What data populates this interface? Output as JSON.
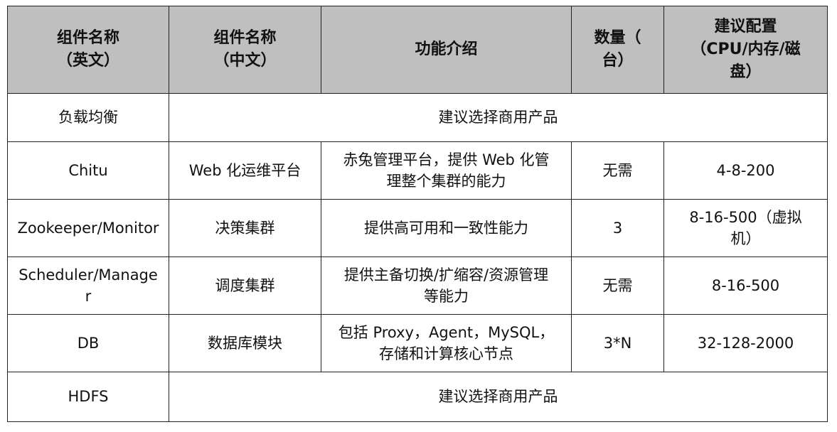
{
  "header": {
    "name_en": [
      "组件名称",
      "（英文）"
    ],
    "name_zh": [
      "组件名称",
      "（中文）"
    ],
    "function": "功能介绍",
    "quantity": [
      "数量（",
      "台）"
    ],
    "config": [
      "建议配置",
      "（CPU/内存/磁",
      "盘）"
    ]
  },
  "rows": {
    "load_balancer": {
      "name_en": "负载均衡",
      "merged_note": "建议选择商用产品"
    },
    "chitu": {
      "name_en": "Chitu",
      "name_zh": "Web 化运维平台",
      "function": [
        "赤兔管理平台，提供 Web 化管",
        "理整个集群的能力"
      ],
      "quantity": "无需",
      "config": "4-8-200"
    },
    "zookeeper": {
      "name_en": "Zookeeper/Monitor",
      "name_zh": "决策集群",
      "function": "提供高可用和一致性能力",
      "quantity": "3",
      "config": [
        "8-16-500（虚拟",
        "机）"
      ]
    },
    "scheduler": {
      "name_en": [
        "Scheduler/Manage",
        "r"
      ],
      "name_zh": "调度集群",
      "function": [
        "提供主备切换/扩缩容/资源管理",
        "等能力"
      ],
      "quantity": "无需",
      "config": "8-16-500"
    },
    "db": {
      "name_en": "DB",
      "name_zh": "数据库模块",
      "function": [
        "包括 Proxy，Agent，MySQL，",
        "存储和计算核心节点"
      ],
      "quantity": "3*N",
      "config": "32-128-2000"
    },
    "hdfs": {
      "name_en": "HDFS",
      "merged_note": "建议选择商用产品"
    }
  }
}
